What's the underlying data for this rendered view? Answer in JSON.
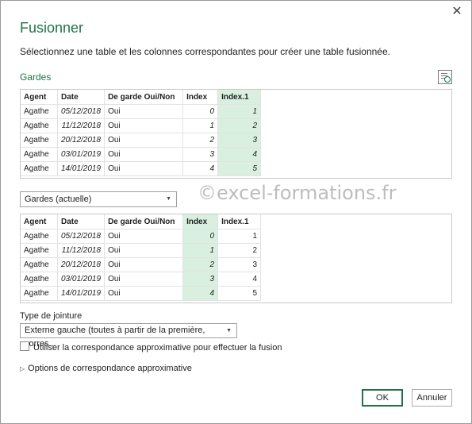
{
  "dialog": {
    "close_glyph": "✕",
    "title": "Fusionner",
    "subtitle": "Sélectionnez une table et les colonnes correspondantes pour créer une table fusionnée."
  },
  "first_table": {
    "label": "Gardes",
    "preview_icon": "table-preview-icon",
    "headers": [
      "Agent",
      "Date",
      "De garde Oui/Non",
      "Index",
      "Index.1"
    ],
    "rows": [
      [
        "Agathe",
        "05/12/2018",
        "Oui",
        "0",
        "1"
      ],
      [
        "Agathe",
        "11/12/2018",
        "Oui",
        "1",
        "2"
      ],
      [
        "Agathe",
        "20/12/2018",
        "Oui",
        "2",
        "3"
      ],
      [
        "Agathe",
        "03/01/2019",
        "Oui",
        "3",
        "4"
      ],
      [
        "Agathe",
        "14/01/2019",
        "Oui",
        "4",
        "5"
      ]
    ],
    "selected_column": "Index.1"
  },
  "second_table": {
    "dropdown_value": "Gardes (actuelle)",
    "headers": [
      "Agent",
      "Date",
      "De garde Oui/Non",
      "Index",
      "Index.1"
    ],
    "rows": [
      [
        "Agathe",
        "05/12/2018",
        "Oui",
        "0",
        "1"
      ],
      [
        "Agathe",
        "11/12/2018",
        "Oui",
        "1",
        "2"
      ],
      [
        "Agathe",
        "20/12/2018",
        "Oui",
        "2",
        "3"
      ],
      [
        "Agathe",
        "03/01/2019",
        "Oui",
        "3",
        "4"
      ],
      [
        "Agathe",
        "14/01/2019",
        "Oui",
        "4",
        "5"
      ]
    ],
    "selected_column": "Index"
  },
  "watermark": "©excel-formations.fr",
  "join": {
    "label": "Type de jointure",
    "value": "Externe gauche (toutes à partir de la première, corres..."
  },
  "fuzzy_checkbox": {
    "label": "Utiliser la correspondance approximative pour effectuer la fusion",
    "checked": false
  },
  "fuzzy_options": {
    "label": "Options de correspondance approximative"
  },
  "buttons": {
    "ok": "OK",
    "cancel": "Annuler"
  },
  "colors": {
    "accent": "#217346",
    "selected_column": "#d9f0e0"
  }
}
